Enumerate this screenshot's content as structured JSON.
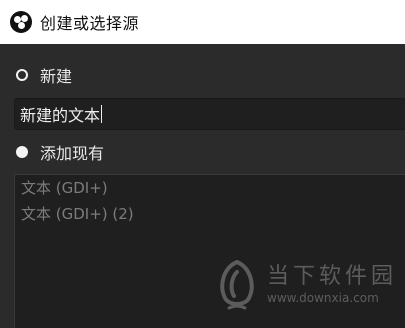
{
  "window": {
    "title": "创建或选择源",
    "icon": "obs-logo-icon"
  },
  "create_new": {
    "label": "新建",
    "selected": false,
    "input_value": "新建的文本"
  },
  "add_existing": {
    "label": "添加现有",
    "selected": true,
    "items": [
      "文本 (GDI+)",
      "文本 (GDI+) (2)"
    ]
  },
  "watermark": {
    "name": "当下软件园",
    "url": "www.downxia.com"
  },
  "colors": {
    "dialog_background": "#2b2b2b",
    "input_background": "#1f1f1f",
    "titlebar_background": "#ffffff",
    "disabled_text": "#7c7c7c"
  }
}
